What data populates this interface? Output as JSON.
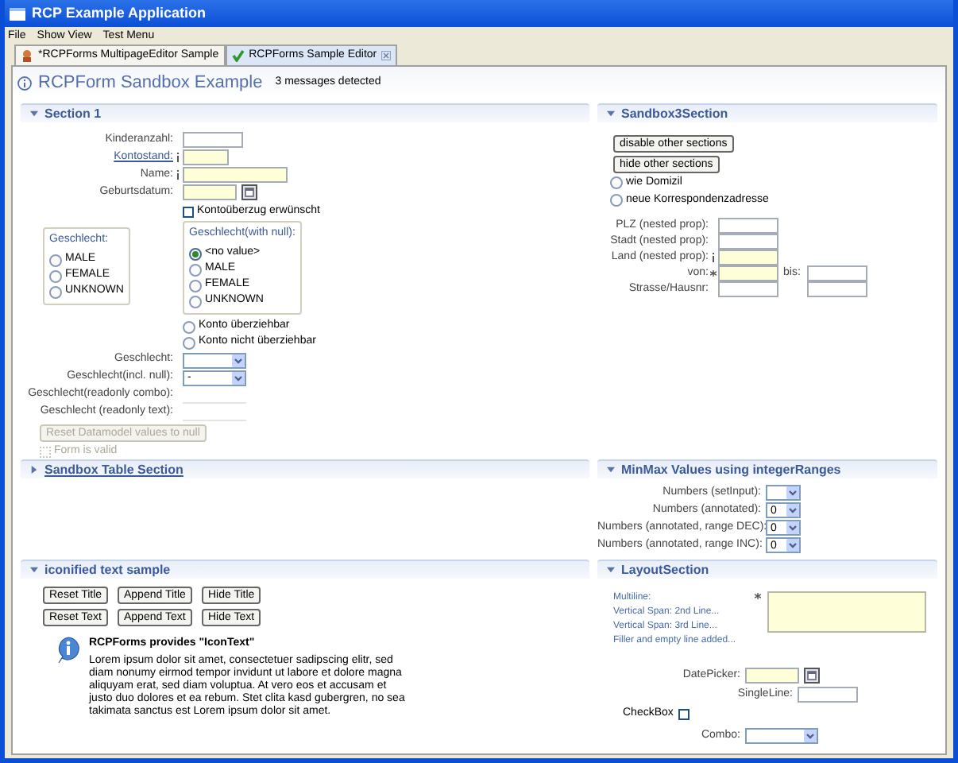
{
  "window": {
    "title": "RCP Example Application"
  },
  "menu": [
    {
      "label": "File"
    },
    {
      "label": "Show View"
    },
    {
      "label": "Test Menu"
    }
  ],
  "tabs": [
    {
      "label": "*RCPForms MultipageEditor Sample",
      "selected": false,
      "closable": false
    },
    {
      "label": "RCPForms Sample Editor",
      "selected": true,
      "closable": true
    }
  ],
  "form": {
    "title": "RCPForm Sandbox Example",
    "message": "3 messages detected"
  },
  "section1": {
    "title": "Section 1",
    "expanded": true,
    "fields": [
      {
        "label": "Kinderanzahl:",
        "link": false,
        "info_mark": false,
        "mandatory": false,
        "kind": "text"
      },
      {
        "label": "Kontostand:",
        "link": true,
        "info_mark": true,
        "mandatory": true,
        "kind": "text"
      },
      {
        "label": "Name:",
        "link": false,
        "info_mark": true,
        "mandatory": true,
        "kind": "text"
      },
      {
        "label": "Geburtsdatum:",
        "link": false,
        "info_mark": false,
        "mandatory": true,
        "kind": "date"
      }
    ],
    "checkbox": {
      "label": "Kontoüberzug erwünscht",
      "checked": false
    },
    "group_left": {
      "title": "Geschlecht:",
      "options": [
        {
          "label": "MALE",
          "selected": false
        },
        {
          "label": "FEMALE",
          "selected": false
        },
        {
          "label": "UNKNOWN",
          "selected": false
        }
      ]
    },
    "group_right": {
      "title": "Geschlecht(with null):",
      "options": [
        {
          "label": "<no value>",
          "selected": true
        },
        {
          "label": "MALE",
          "selected": false
        },
        {
          "label": "FEMALE",
          "selected": false
        },
        {
          "label": "UNKNOWN",
          "selected": false
        }
      ]
    },
    "radios": [
      {
        "label": "Konto überziehbar",
        "selected": false
      },
      {
        "label": "Konto nicht überziehbar",
        "selected": false
      }
    ],
    "combos": [
      {
        "label": "Geschlecht:"
      },
      {
        "label": "Geschlecht(incl. null):",
        "value": "-"
      }
    ],
    "readonly": [
      {
        "label": "Geschlecht(readonly combo):"
      },
      {
        "label": "Geschlecht (readonly text):"
      }
    ],
    "reset_button": {
      "label": "Reset Datamodel values to null",
      "disabled": true
    },
    "valid_checkbox": {
      "label": "Form is valid",
      "checked": false,
      "disabled": true
    }
  },
  "table_section": {
    "title": "Sandbox Table Section",
    "expanded": false
  },
  "iconified": {
    "title": "iconified text sample",
    "expanded": true,
    "buttons": [
      {
        "label": "Reset Title"
      },
      {
        "label": "Append Title"
      },
      {
        "label": "Hide Title"
      },
      {
        "label": "Reset Text"
      },
      {
        "label": "Append Text"
      },
      {
        "label": "Hide Text"
      }
    ],
    "heading": "RCPForms provides \"IconText\"",
    "text": "Lorem ipsum dolor sit amet, consectetuer sadipscing elitr, sed diam nonumy eirmod tempor invidunt ut labore et dolore magna aliquyam erat, sed diam voluptua. At vero eos et accusam et justo duo dolores et ea rebum. Stet clita kasd gubergren, no sea takimata sanctus est Lorem ipsum dolor sit amet."
  },
  "sandbox3": {
    "title": "Sandbox3Section",
    "expanded": true,
    "buttons": [
      {
        "label": "disable other sections"
      },
      {
        "label": "hide other sections"
      }
    ],
    "radios": [
      {
        "label": "wie Domizil",
        "selected": false
      },
      {
        "label": "neue Korrespondenzadresse",
        "selected": false
      }
    ],
    "fields": [
      {
        "label": "PLZ (nested prop):",
        "info_mark": false,
        "required_mark": false,
        "mandatory": false,
        "second_field": false
      },
      {
        "label": "Stadt (nested prop):",
        "info_mark": false,
        "required_mark": false,
        "mandatory": false,
        "second_field": false
      },
      {
        "label": "Land (nested prop):",
        "info_mark": true,
        "required_mark": false,
        "mandatory": true,
        "second_field": false
      },
      {
        "label": "von:",
        "info_mark": false,
        "required_mark": true,
        "mandatory": true,
        "second_field": true,
        "second_label": "bis:"
      },
      {
        "label": "Strasse/Hausnr:",
        "info_mark": false,
        "required_mark": false,
        "mandatory": false,
        "second_field": true
      }
    ]
  },
  "minmax": {
    "title": "MinMax Values using integerRanges",
    "expanded": true,
    "combos": [
      {
        "label": "Numbers (setInput):"
      },
      {
        "label": "Numbers (annotated):",
        "value": "0"
      },
      {
        "label": "Numbers (annotated, range DEC):",
        "value": "0"
      },
      {
        "label": "Numbers (annotated, range INC):",
        "value": "0"
      }
    ]
  },
  "layout_section": {
    "title": "LayoutSection",
    "expanded": true,
    "lines": [
      "Multiline:",
      "Vertical Span: 2nd Line...",
      "Vertical Span: 3rd Line...",
      "Filler and empty line added..."
    ],
    "datepicker": {
      "label": "DatePicker:"
    },
    "singleline": {
      "label": "SingleLine:"
    },
    "checkbox": {
      "label": "CheckBox",
      "checked": false
    },
    "combo": {
      "label": "Combo:"
    }
  }
}
